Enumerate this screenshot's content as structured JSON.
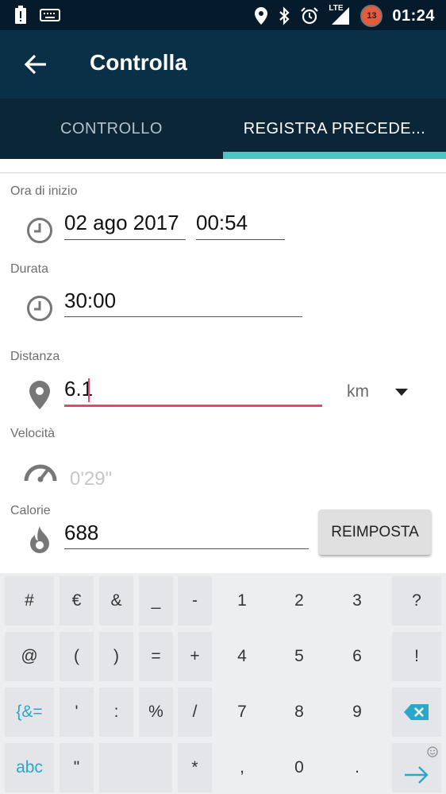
{
  "status_bar": {
    "time": "01:24",
    "lte": "LTE",
    "badge": "13"
  },
  "app_bar": {
    "title": "Controlla"
  },
  "tabs": [
    {
      "label": "CONTROLLO"
    },
    {
      "label": "REGISTRA PRECEDE..."
    }
  ],
  "form": {
    "start_label": "Ora di inizio",
    "start_date": "02 ago 2017",
    "start_time": "00:54",
    "duration_label": "Durata",
    "duration": "30:00",
    "distance_label": "Distanza",
    "distance": "6.1",
    "unit": "km",
    "speed_label": "Velocità",
    "speed": "0'29\"",
    "calories_label": "Calorie",
    "calories": "688",
    "reset_label": "REIMPOSTA"
  },
  "keyboard": {
    "row1": [
      "#",
      "€",
      "&",
      "_",
      "-",
      "1",
      "2",
      "3",
      "?"
    ],
    "row2": [
      "@",
      "(",
      ")",
      "=",
      "+",
      "4",
      "5",
      "6",
      "!"
    ],
    "row3": [
      "{&=",
      "'",
      ":",
      "%",
      "/",
      "7",
      "8",
      "9"
    ],
    "row4": [
      "abc",
      "\"",
      "*",
      ",",
      "0",
      "."
    ]
  }
}
